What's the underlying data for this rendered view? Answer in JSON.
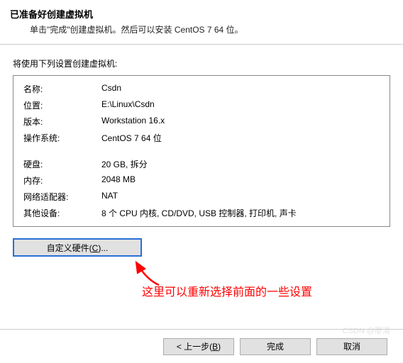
{
  "header": {
    "title": "已准备好创建虚拟机",
    "subtitle": "单击\"完成\"创建虚拟机。然后可以安装 CentOS 7 64 位。"
  },
  "section_label": "将使用下列设置创建虚拟机:",
  "summary": {
    "rows": [
      {
        "label": "名称:",
        "value": "Csdn"
      },
      {
        "label": "位置:",
        "value": "E:\\Linux\\Csdn"
      },
      {
        "label": "版本:",
        "value": "Workstation 16.x"
      },
      {
        "label": "操作系统:",
        "value": "CentOS 7 64 位"
      }
    ],
    "rows2": [
      {
        "label": "硬盘:",
        "value": "20 GB, 拆分"
      },
      {
        "label": "内存:",
        "value": "2048 MB"
      },
      {
        "label": "网络适配器:",
        "value": "NAT"
      },
      {
        "label": "其他设备:",
        "value": "8 个 CPU 内核, CD/DVD, USB 控制器, 打印机, 声卡"
      }
    ]
  },
  "buttons": {
    "customize_prefix": "自定义硬件(",
    "customize_key": "C",
    "customize_suffix": ")...",
    "back_prefix": "< 上一步(",
    "back_key": "B",
    "back_suffix": ")",
    "finish": "完成",
    "cancel": "取消"
  },
  "annotation": "这里可以重新选择前面的一些设置",
  "watermark": "CSDN @廖清"
}
